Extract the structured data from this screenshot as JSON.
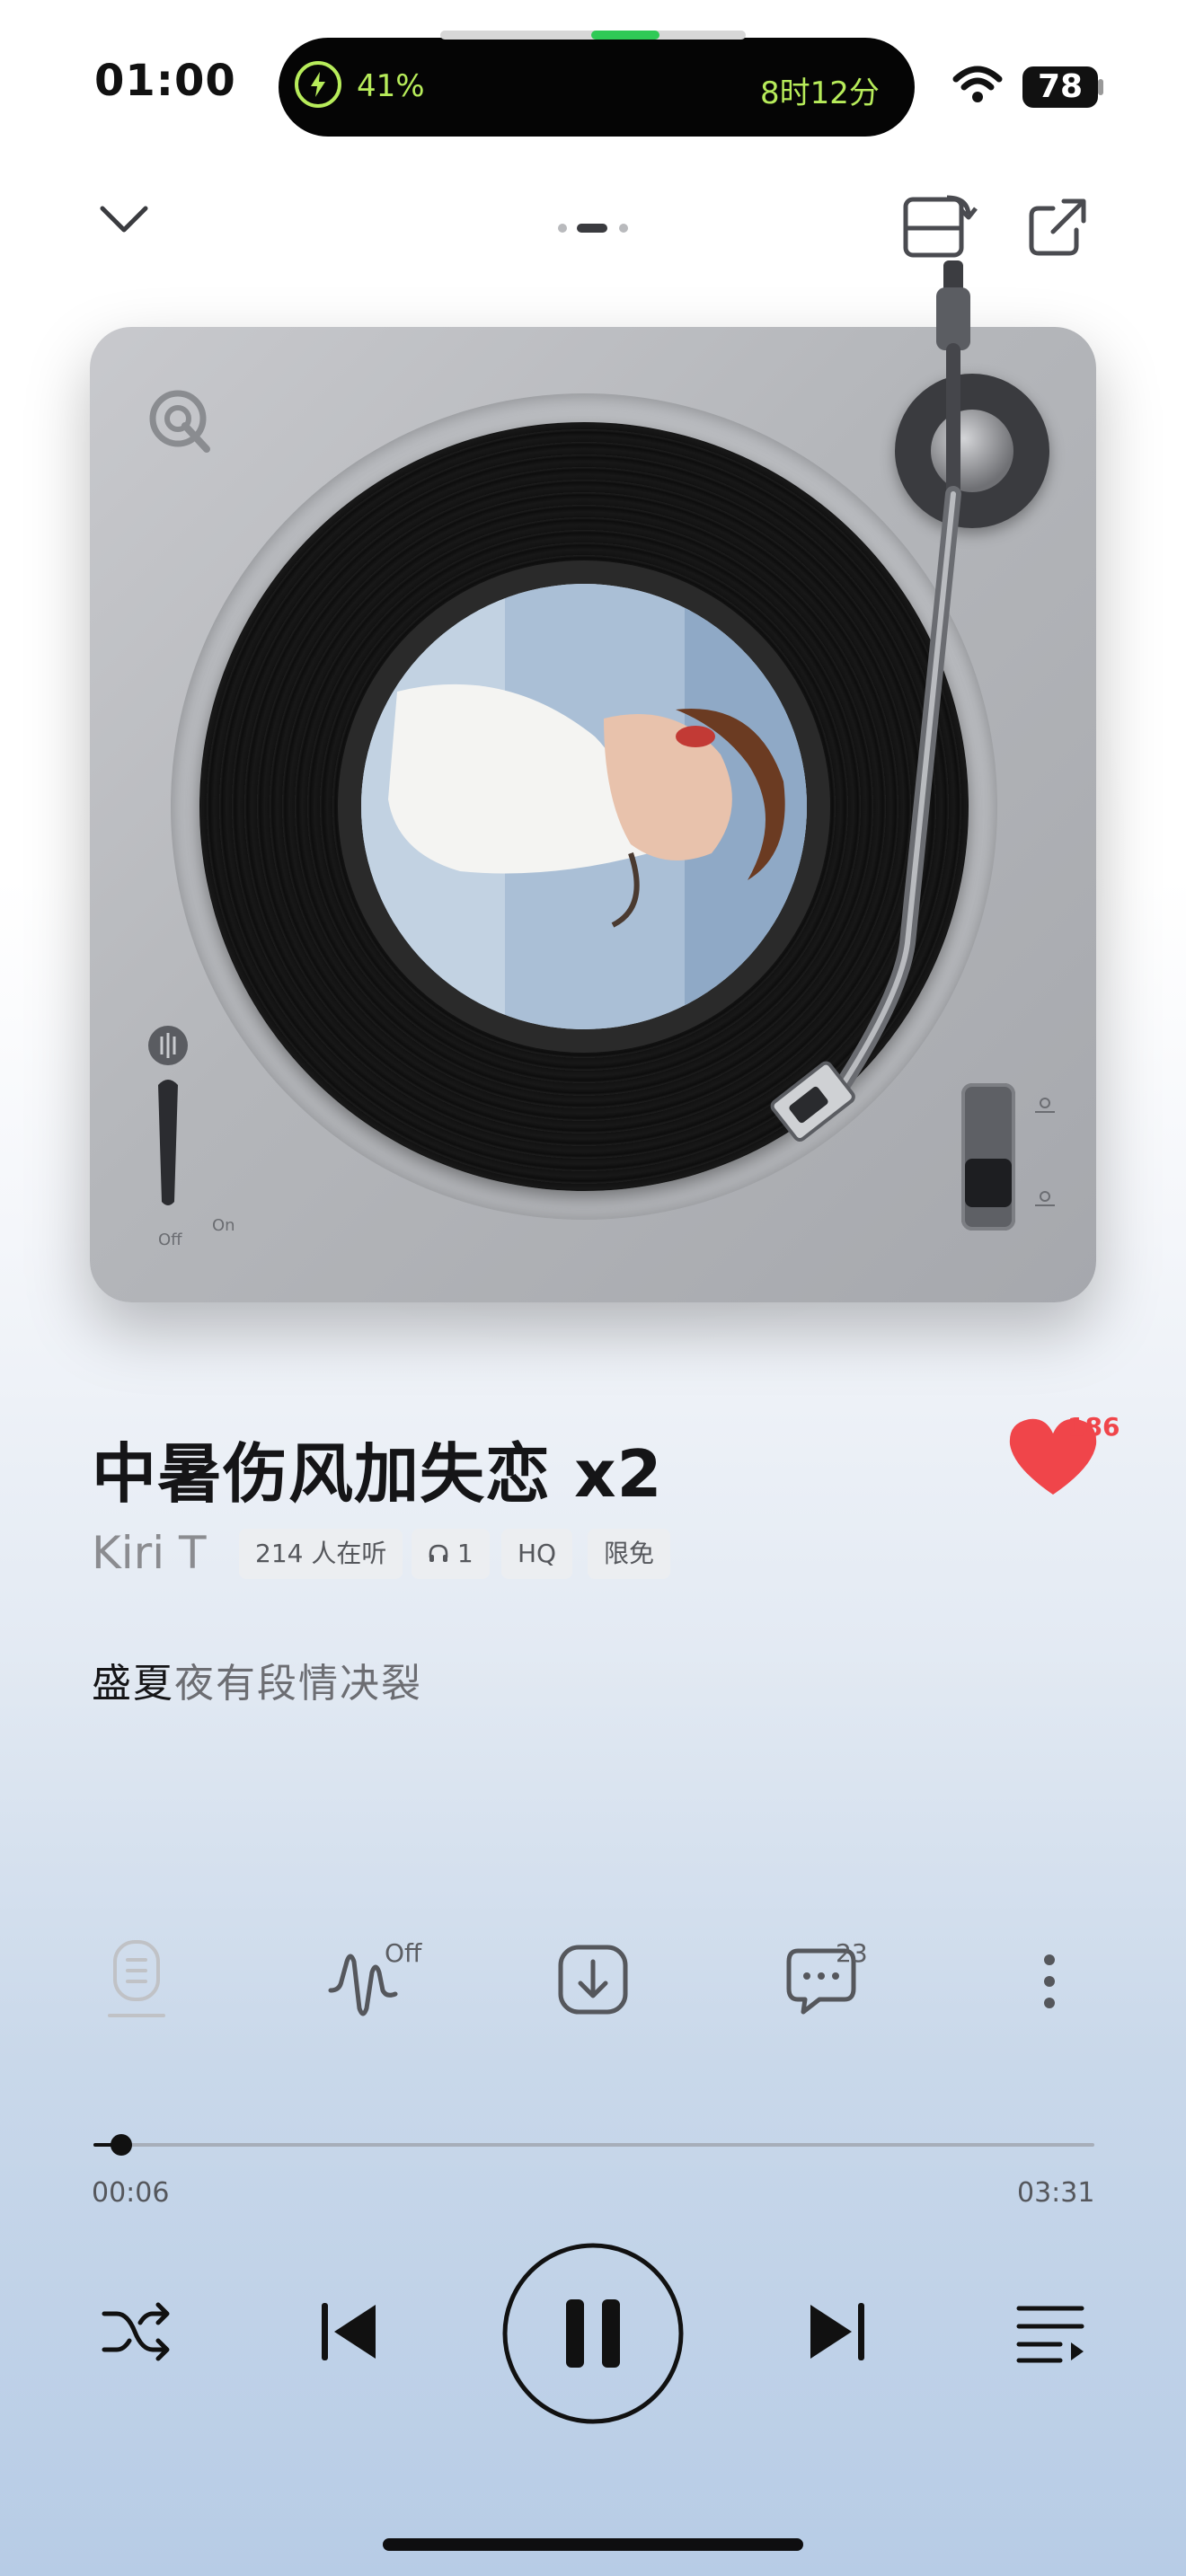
{
  "status_bar": {
    "time": "01:00",
    "battery_percent_label": "41%",
    "timer_label": "8时12分",
    "battery_level": "78"
  },
  "nav": {
    "collapse_icon": "chevron-down-icon",
    "page_indicator_icon": "page-dots-icon",
    "rotate_icon": "rotate-screen-icon",
    "share_icon": "share-icon"
  },
  "player": {
    "switch_off_label": "Off",
    "switch_on_label": "On"
  },
  "song": {
    "title": "中暑伤风加失恋 x2",
    "artist": "Kiri T",
    "listeners": "214 人在听",
    "headphone_count": "1",
    "quality": "HQ",
    "free_badge": "限免",
    "likes": "186",
    "lyric_highlight": "盛夏",
    "lyric_rest": "夜有段情决裂"
  },
  "actions": {
    "effect_state": "Off",
    "comment_count": "23"
  },
  "progress": {
    "current": "00:06",
    "total": "03:31",
    "fraction": 0.028
  },
  "colors": {
    "accent_red": "#f0454a",
    "text_primary": "#151517",
    "island_green": "#b7ec5a"
  }
}
